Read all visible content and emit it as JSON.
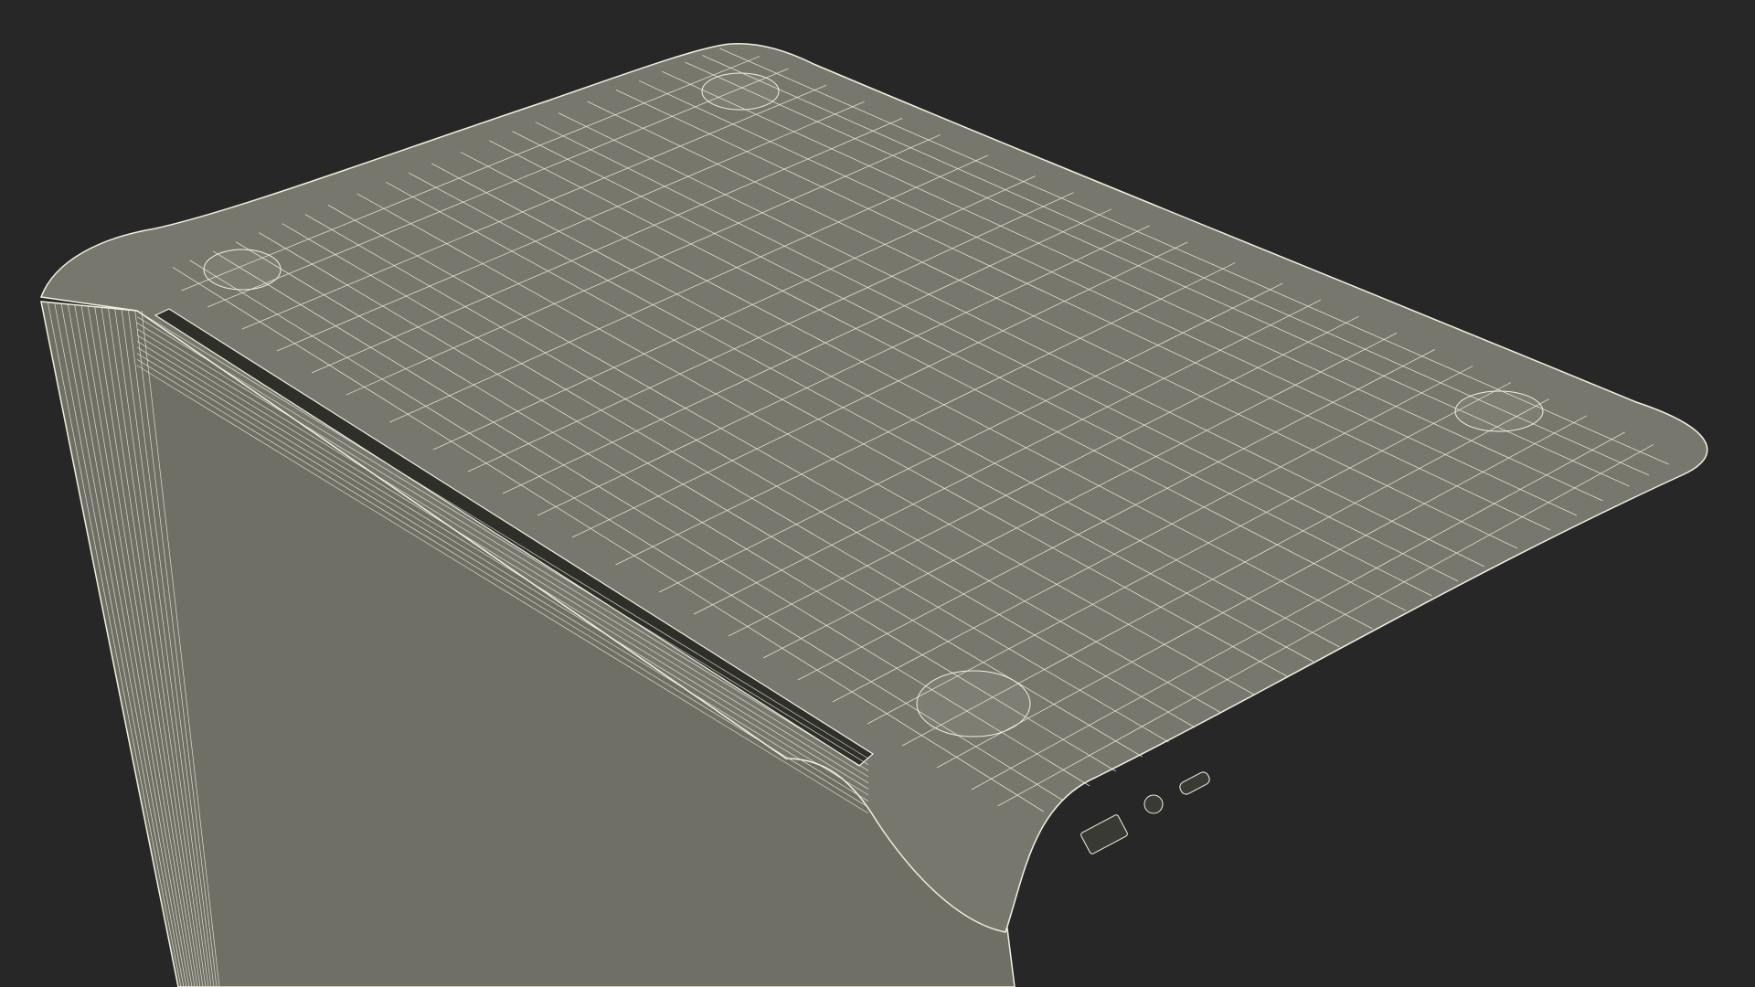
{
  "scene": {
    "subject": "laptop-wireframe",
    "colors": {
      "background": "#272727",
      "surface": "#77776d",
      "surface_dark": "#6a6a61",
      "wire": "#f2f0e0",
      "slot": "#2e2e2a"
    }
  }
}
